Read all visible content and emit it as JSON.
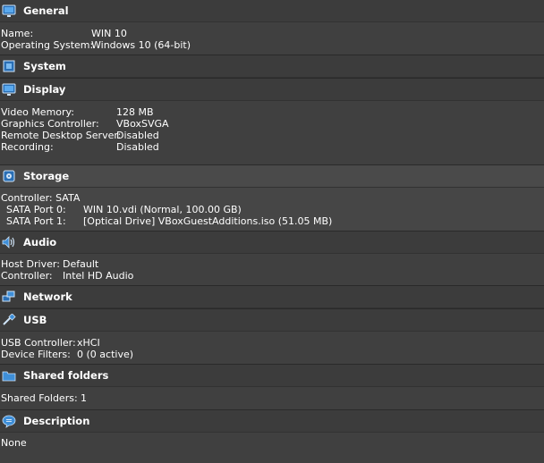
{
  "general": {
    "title": "General",
    "icon": "monitor-icon",
    "rows": [
      {
        "key": "Name:",
        "value": "WIN 10"
      },
      {
        "key": "Operating System:",
        "value": "Windows 10 (64-bit)"
      }
    ]
  },
  "system": {
    "title": "System",
    "icon": "chip-icon"
  },
  "display": {
    "title": "Display",
    "icon": "monitor-icon",
    "rows": [
      {
        "key": "Video Memory:",
        "value": "128 MB"
      },
      {
        "key": "Graphics Controller:",
        "value": "VBoxSVGA"
      },
      {
        "key": "Remote Desktop Server:",
        "value": "Disabled"
      },
      {
        "key": "Recording:",
        "value": "Disabled"
      }
    ]
  },
  "storage": {
    "title": "Storage",
    "icon": "disk-icon",
    "controller": "Controller: SATA",
    "rows": [
      {
        "key": "SATA Port 0:",
        "value": "WIN 10.vdi (Normal, 100.00 GB)"
      },
      {
        "key": "SATA Port 1:",
        "value": "[Optical Drive] VBoxGuestAdditions.iso (51.05 MB)"
      }
    ]
  },
  "audio": {
    "title": "Audio",
    "icon": "speaker-icon",
    "rows": [
      {
        "key": "Host Driver:",
        "value": "Default"
      },
      {
        "key": "Controller:",
        "value": "Intel HD Audio"
      }
    ]
  },
  "network": {
    "title": "Network",
    "icon": "network-icon"
  },
  "usb": {
    "title": "USB",
    "icon": "usb-icon",
    "rows": [
      {
        "key": "USB Controller:",
        "value": "xHCI"
      },
      {
        "key": "Device Filters:",
        "value": "0 (0 active)"
      }
    ]
  },
  "shared": {
    "title": "Shared folders",
    "icon": "folder-icon",
    "rows": [
      {
        "key": "Shared Folders:",
        "value": "1"
      }
    ]
  },
  "description": {
    "title": "Description",
    "icon": "speech-bubble-icon",
    "text": "None"
  },
  "colors": {
    "background": "#3b3b3b",
    "icon_blue": "#3f8fd8"
  }
}
